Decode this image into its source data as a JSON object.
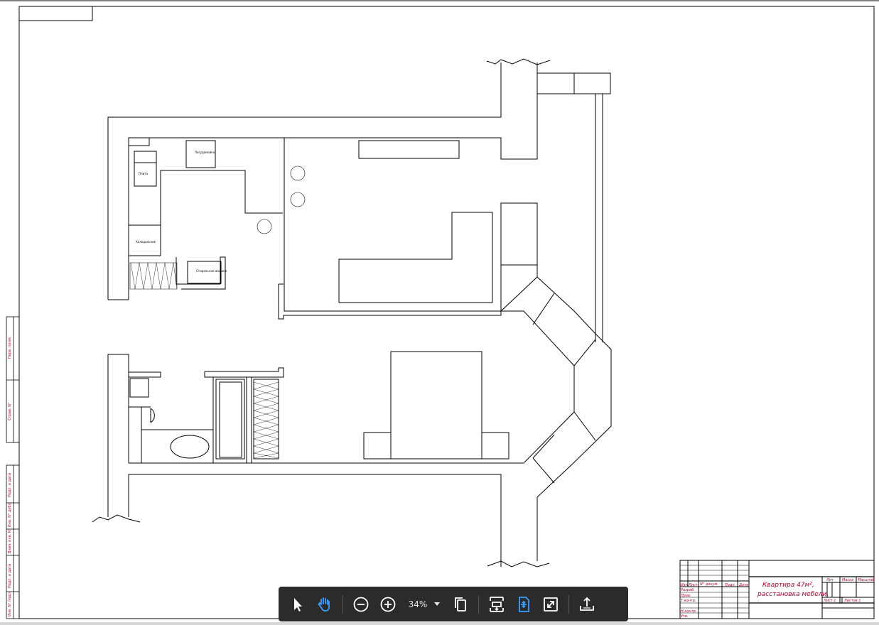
{
  "title_block": {
    "title_line1": "Квартира 47м²,",
    "title_line2": "расстановка мебели.",
    "col_lit": "Лит",
    "col_mass": "Масса",
    "col_scale": "Масштаб",
    "sheet": "Лист 1",
    "sheets": "Листов 1",
    "row_izm": "Изм",
    "row_list": "Лист",
    "row_ndoc": "N° докум.",
    "row_podp": "Подп.",
    "row_data": "Дата",
    "row_razrab": "Разраб.",
    "row_prov": "Пров.",
    "row_tkontr": "Т.контр.",
    "row_nkontr": "Н.контр.",
    "row_utv": "Утв."
  },
  "side_stamps": [
    "Перв. прим.",
    "Справ. N°",
    "Подп. и дата",
    "Инв. N° дубл.",
    "Взам. инв. N°",
    "Подп. и дата",
    "Инв. N° подл."
  ],
  "furniture_labels": {
    "stove": "Плита",
    "dishwasher": "Посудомойка",
    "fridge": "Холодильник",
    "washer": "Стиральная машина"
  },
  "toolbar": {
    "zoom_value": "34%",
    "icons": [
      "select-arrow-icon",
      "hand-pan-icon",
      "zoom-out-icon",
      "zoom-in-icon",
      "page-view-icon",
      "fit-page-icon",
      "fit-width-icon",
      "fullscreen-icon",
      "share-icon"
    ],
    "active": "hand-pan-icon",
    "accent": "#3aa0ff"
  }
}
